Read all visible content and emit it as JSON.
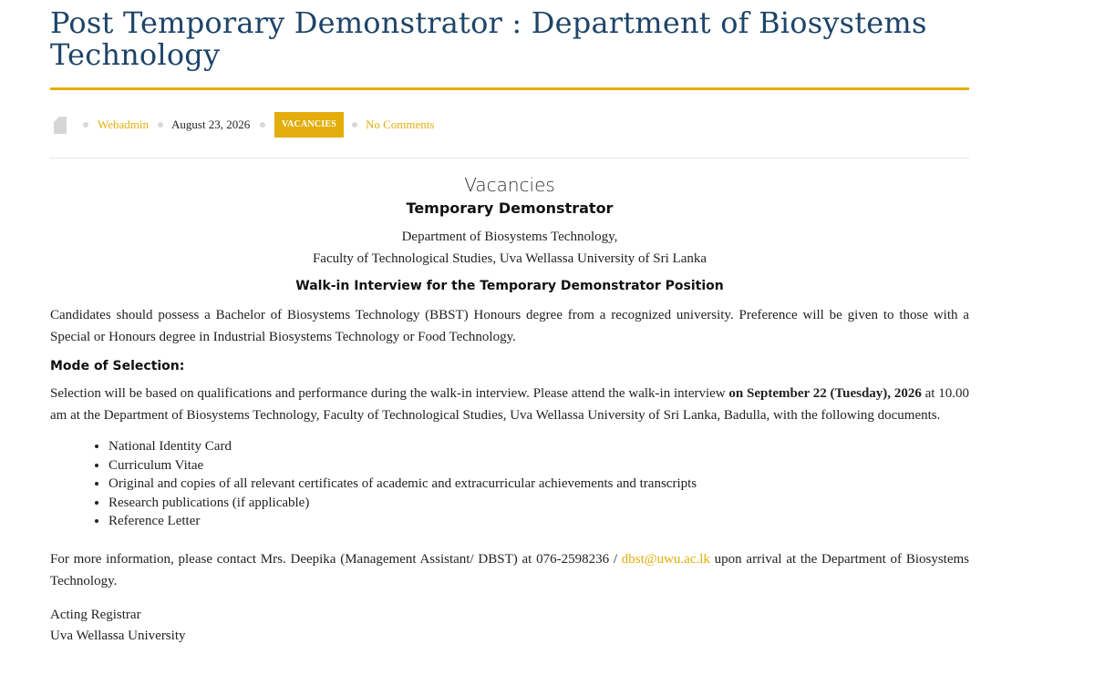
{
  "post": {
    "title": "Post Temporary Demonstrator : Department of Biosystems Technology",
    "meta": {
      "doc_icon": "document-icon",
      "author": "Webadmin",
      "date": "August 23, 2026",
      "category": "VACANCIES",
      "comments": "No Comments"
    },
    "colors": {
      "title": "#1d4468",
      "accent": "#e3ae0b"
    }
  },
  "content": {
    "heading": "Vacancies",
    "position": "Temporary Demonstrator",
    "department_line1": "Department of Biosystems Technology,",
    "department_line2": "Faculty of Technological Studies, Uva Wellassa University of Sri Lanka",
    "walkin_heading": "Walk-in Interview for the Temporary Demonstrator Position",
    "eligibility": "Candidates should possess a Bachelor of Biosystems Technology (BBST) Honours degree from a recognized university. Preference will be given to those with a Special or Honours degree in Industrial Biosystems Technology or Food Technology.",
    "mode_heading": "Mode of Selection:",
    "selection_part1": "Selection will be based on qualifications and performance during the walk-in interview. Please attend the walk-in interview ",
    "selection_bold": "on September 22 (Tuesday), 2026",
    "selection_part2": " at 10.00 am at the Department of Biosystems Technology, Faculty of Technological Studies, Uva Wellassa University of Sri Lanka, Badulla, with the following documents.",
    "documents": [
      "National Identity Card",
      "Curriculum Vitae",
      "Original and copies of all relevant certificates of academic and extracurricular achievements and transcripts",
      "Research publications (if applicable)",
      "Reference Letter"
    ],
    "contact_part1": "For more information, please contact Mrs. Deepika (Management Assistant/ DBST) at 076-2598236 / ",
    "contact_email": "dbst@uwu.ac.lk",
    "contact_part2": " upon arrival at the Department of Biosystems Technology.",
    "signoff_title": "Acting Registrar",
    "signoff_org": "Uva Wellassa University"
  }
}
